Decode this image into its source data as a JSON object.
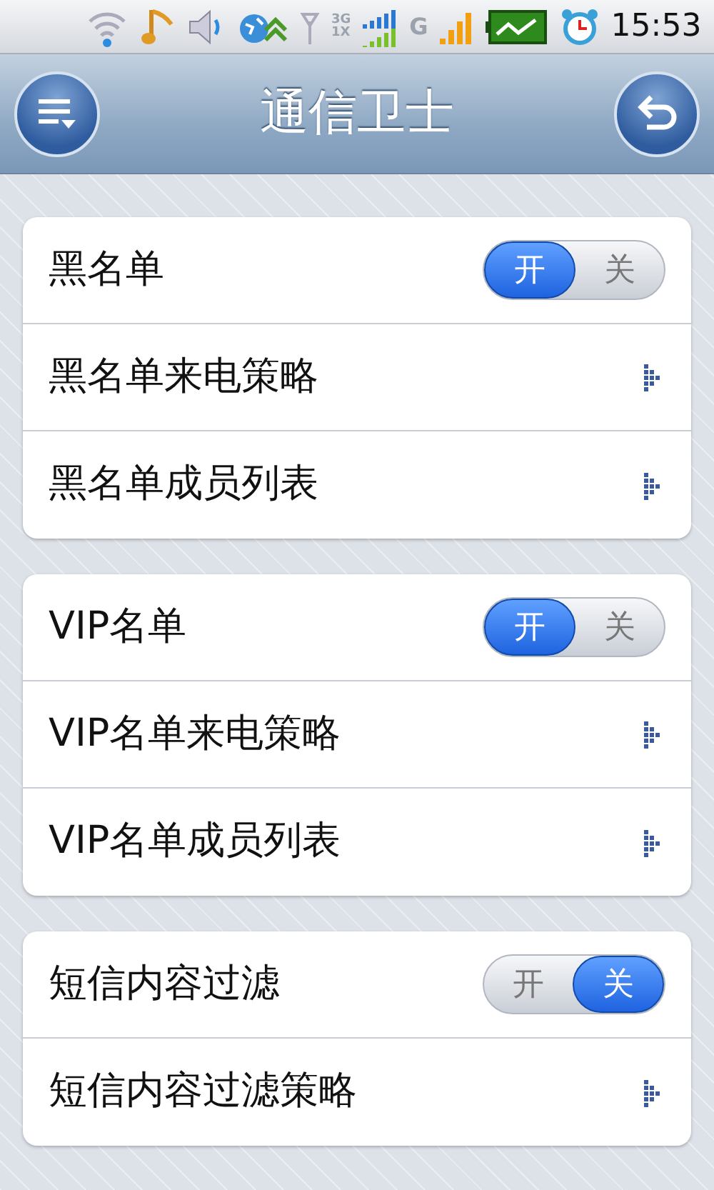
{
  "status_bar": {
    "network_labels": [
      "3G",
      "1X"
    ],
    "second_network_label": "G",
    "time": "15:53"
  },
  "header": {
    "title": "通信卫士"
  },
  "groups": [
    {
      "items": [
        {
          "kind": "toggle",
          "label": "黑名单",
          "on": true,
          "on_label": "开",
          "off_label": "关"
        },
        {
          "kind": "link",
          "label": "黑名单来电策略"
        },
        {
          "kind": "link",
          "label": "黑名单成员列表"
        }
      ]
    },
    {
      "items": [
        {
          "kind": "toggle",
          "label": "VIP名单",
          "on": true,
          "on_label": "开",
          "off_label": "关"
        },
        {
          "kind": "link",
          "label": "VIP名单来电策略"
        },
        {
          "kind": "link",
          "label": "VIP名单成员列表"
        }
      ]
    },
    {
      "items": [
        {
          "kind": "toggle",
          "label": "短信内容过滤",
          "on": false,
          "on_label": "开",
          "off_label": "关"
        },
        {
          "kind": "link",
          "label": "短信内容过滤策略"
        }
      ]
    }
  ]
}
